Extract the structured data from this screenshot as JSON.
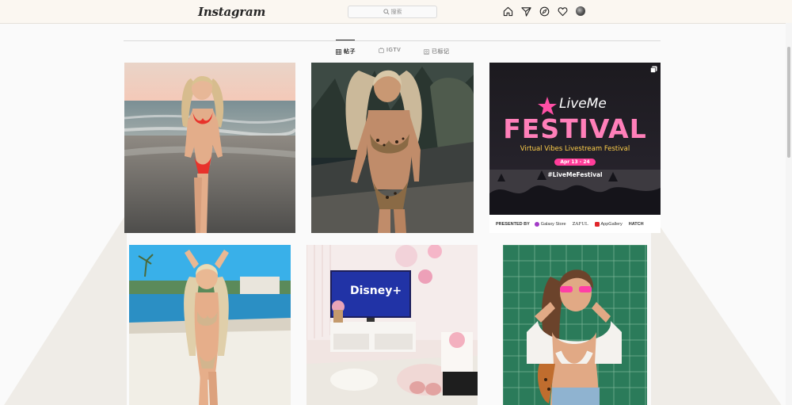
{
  "app": {
    "logo": "Instagram"
  },
  "search": {
    "placeholder": "搜索"
  },
  "nav": {
    "icons": [
      "home-icon",
      "direct-icon",
      "explore-icon",
      "activity-icon",
      "profile-avatar"
    ]
  },
  "tabs": [
    {
      "label": "帖子",
      "icon": "grid-icon",
      "active": true
    },
    {
      "label": "IGTV",
      "icon": "igtv-icon",
      "active": false
    },
    {
      "label": "已标记",
      "icon": "tagged-icon",
      "active": false
    }
  ],
  "festival": {
    "brand": "LiveMe",
    "title": "FESTIVAL",
    "subtitle": "Virtual Vibes Livestream Festival",
    "dates": "Apr 13 - 24",
    "hashtag": "#LiveMeFestival",
    "presented_by": "PRESENTED BY",
    "sponsors": [
      "Galaxy Store",
      "ZAFUL",
      "AppGallery",
      "HATCH"
    ]
  },
  "tv_overlay": {
    "brand": "Disney+"
  },
  "colors": {
    "topbar": "#fbf7f1",
    "festival_pink": "#ff5fa8",
    "festival_gold": "#ffcf4a",
    "date_pill": "#ff3d9a"
  }
}
